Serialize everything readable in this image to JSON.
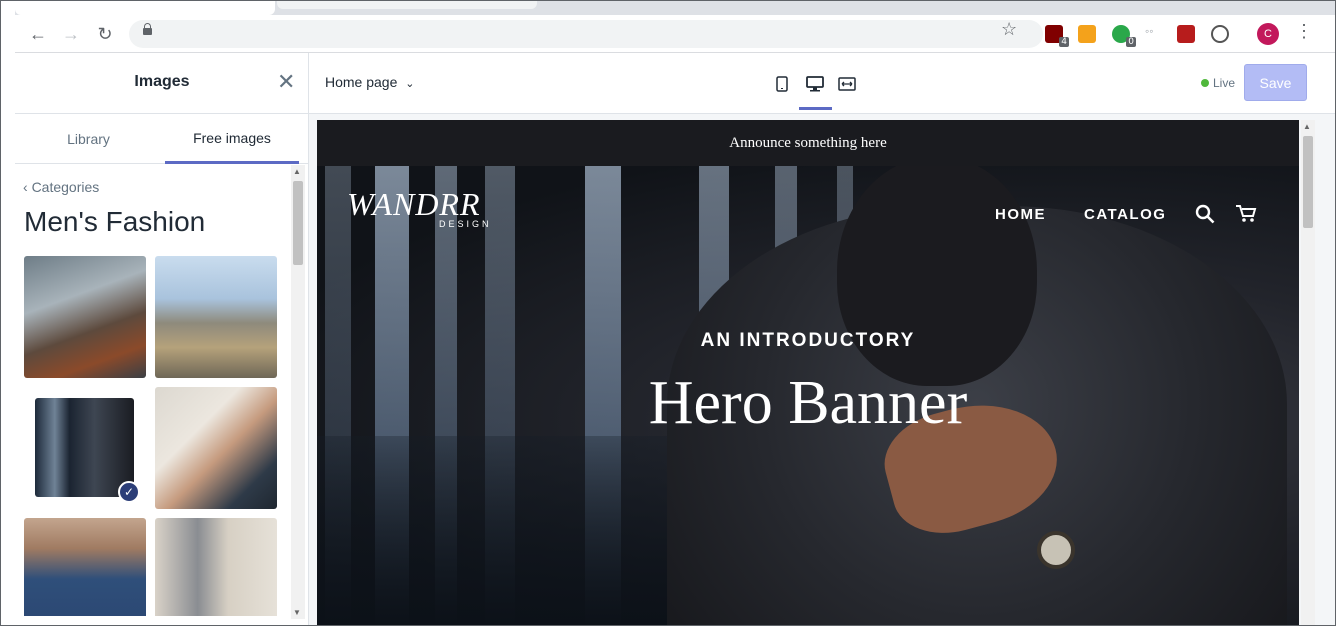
{
  "browser": {
    "extension_badges": [
      "4",
      "0"
    ],
    "avatar_initial": "C"
  },
  "panel": {
    "title": "Images",
    "tabs": [
      {
        "label": "Library",
        "active": false
      },
      {
        "label": "Free images",
        "active": true
      }
    ],
    "back_label": "Categories",
    "category_title": "Men's Fashion",
    "selected_thumbnail_index": 2
  },
  "topbar": {
    "page_select": "Home page",
    "live_label": "Live",
    "save_label": "Save"
  },
  "preview": {
    "announcement": "Announce something here",
    "logo_main": "WANDRR",
    "logo_sub": "DESIGN",
    "menu": [
      "HOME",
      "CATALOG"
    ],
    "hero_kicker": "AN INTRODUCTORY",
    "hero_title": "Hero Banner"
  },
  "colors": {
    "accent": "#5c6ac4",
    "save_disabled": "#b3bcf5",
    "live_dot": "#50b83c",
    "announcement_bg": "#1a1b1f"
  }
}
